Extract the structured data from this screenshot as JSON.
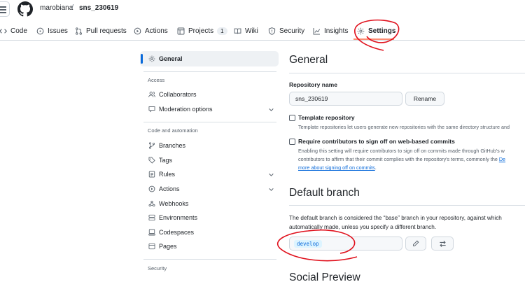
{
  "header": {
    "owner": "marobiana",
    "separator": "/",
    "repo": "sns_230619",
    "menu_icon": "hamburger-icon",
    "logo_icon": "github-mark-icon"
  },
  "tabs": [
    {
      "label": "Code",
      "icon": "code-icon"
    },
    {
      "label": "Issues",
      "icon": "issue-icon"
    },
    {
      "label": "Pull requests",
      "icon": "pull-request-icon"
    },
    {
      "label": "Actions",
      "icon": "play-icon"
    },
    {
      "label": "Projects",
      "icon": "table-icon",
      "count": "1"
    },
    {
      "label": "Wiki",
      "icon": "book-icon"
    },
    {
      "label": "Security",
      "icon": "shield-icon"
    },
    {
      "label": "Insights",
      "icon": "graph-icon"
    },
    {
      "label": "Settings",
      "icon": "gear-icon",
      "selected": true
    }
  ],
  "sidebar": {
    "general": "General",
    "access_heading": "Access",
    "collaborators": "Collaborators",
    "moderation": "Moderation options",
    "code_heading": "Code and automation",
    "branches": "Branches",
    "tags": "Tags",
    "rules": "Rules",
    "actions": "Actions",
    "webhooks": "Webhooks",
    "environments": "Environments",
    "codespaces": "Codespaces",
    "pages": "Pages",
    "security_heading": "Security"
  },
  "main": {
    "title": "General",
    "repo_name_label": "Repository name",
    "repo_name_value": "sns_230619",
    "rename_button": "Rename",
    "template_label": "Template repository",
    "template_desc": "Template repositories let users generate new repositories with the same directory structure and",
    "signoff_label": "Require contributors to sign off on web-based commits",
    "signoff_desc_1": "Enabling this setting will require contributors to sign off on commits made through GitHub's w",
    "signoff_desc_2": "contributors to affirm that their commit complies with the repository's terms, commonly the",
    "signoff_desc_2_link": "De",
    "signoff_desc_3_link": "more about signing off on commits",
    "signoff_desc_3_end": ".",
    "default_branch_title": "Default branch",
    "default_branch_desc_1": "The default branch is considered the “base” branch in your repository, against which",
    "default_branch_desc_2": "automatically made, unless you specify a different branch.",
    "default_branch_value": "develop",
    "social_preview_title": "Social Preview"
  },
  "colors": {
    "accent": "#0969da",
    "tab_underline": "#fd8c73",
    "annotation": "#e0101c"
  }
}
